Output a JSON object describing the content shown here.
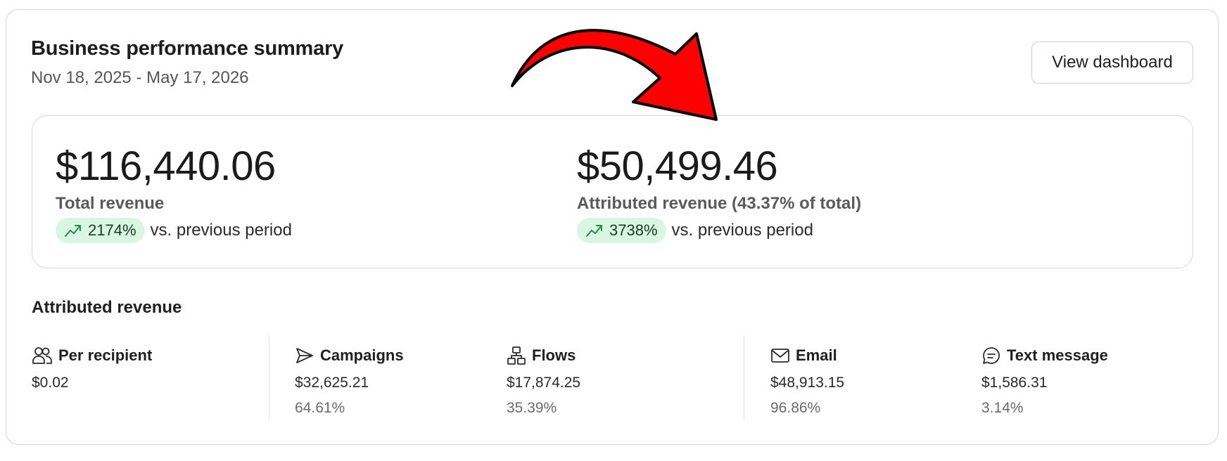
{
  "header": {
    "title": "Business performance summary",
    "date_range": "Nov 18, 2025 - May 17, 2026",
    "view_dashboard_label": "View dashboard"
  },
  "metrics": [
    {
      "value": "$116,440.06",
      "label": "Total revenue",
      "change": "2174%",
      "change_suffix": "vs. previous period",
      "trend_icon": "trending-up-icon"
    },
    {
      "value": "$50,499.46",
      "label": "Attributed revenue (43.37% of total)",
      "change": "3738%",
      "change_suffix": "vs. previous period",
      "trend_icon": "trending-up-icon"
    }
  ],
  "attributed": {
    "title": "Attributed revenue",
    "stats": [
      {
        "icon": "users-icon",
        "label": "Per recipient",
        "value": "$0.02"
      },
      {
        "icon": "send-icon",
        "label": "Campaigns",
        "value": "$32,625.21",
        "percent": "64.61%"
      },
      {
        "icon": "flows-icon",
        "label": "Flows",
        "value": "$17,874.25",
        "percent": "35.39%"
      },
      {
        "icon": "mail-icon",
        "label": "Email",
        "value": "$48,913.15",
        "percent": "96.86%"
      },
      {
        "icon": "chat-icon",
        "label": "Text message",
        "value": "$1,586.31",
        "percent": "3.14%"
      }
    ]
  },
  "colors": {
    "badge_bg": "#d8f6e2",
    "trend_icon": "#1f8a4c",
    "annotation_arrow": "#ff0000",
    "border": "#d6d6d6"
  }
}
